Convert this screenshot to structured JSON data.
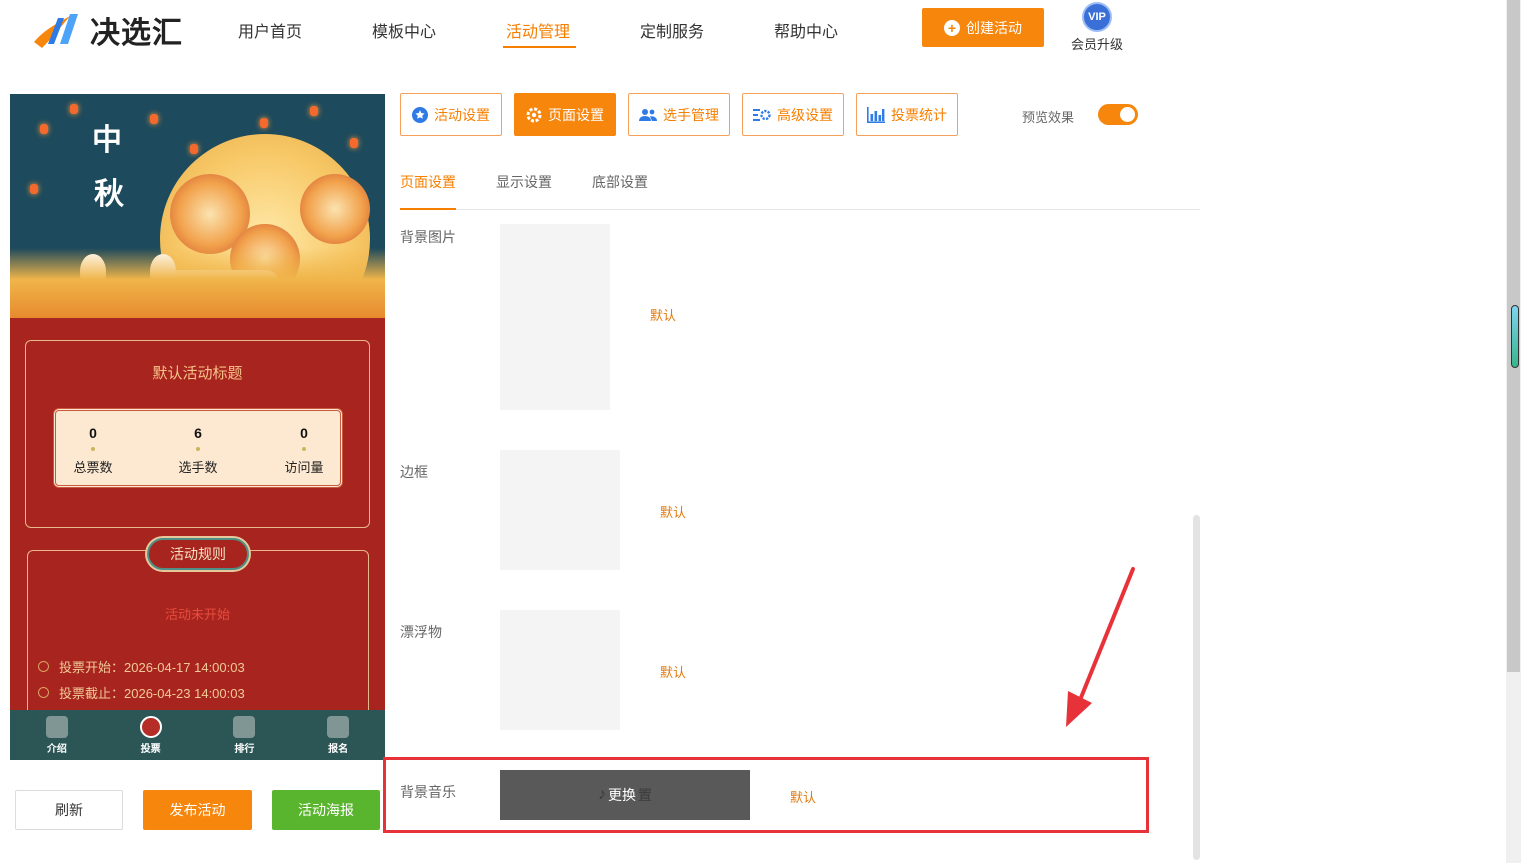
{
  "header": {
    "logo_text": "决选汇",
    "nav": [
      {
        "label": "用户首页"
      },
      {
        "label": "模板中心"
      },
      {
        "label": "活动管理",
        "active": true
      },
      {
        "label": "定制服务"
      },
      {
        "label": "帮助中心"
      }
    ],
    "create_button": "创建活动",
    "vip_badge": "VIP",
    "vip_label": "会员升级"
  },
  "preview": {
    "banner_text_1": "中",
    "banner_text_2": "秋",
    "activity_title": "默认活动标题",
    "stats": [
      {
        "value": "0",
        "label": "总票数"
      },
      {
        "value": "6",
        "label": "选手数"
      },
      {
        "value": "0",
        "label": "访问量"
      }
    ],
    "rules_title": "活动规则",
    "status": "活动未开始",
    "vote_start": "投票开始：2026-04-17 14:00:03",
    "vote_end": "投票截止：2026-04-23 14:00:03",
    "tabbar": [
      {
        "label": "介绍"
      },
      {
        "label": "投票",
        "active": true
      },
      {
        "label": "排行"
      },
      {
        "label": "报名"
      }
    ]
  },
  "actions": {
    "refresh": "刷新",
    "publish": "发布活动",
    "poster": "活动海报"
  },
  "toolbar": {
    "items": [
      {
        "label": "活动设置",
        "icon": "star-icon"
      },
      {
        "label": "页面设置",
        "icon": "gear-icon",
        "active": true
      },
      {
        "label": "选手管理",
        "icon": "users-icon"
      },
      {
        "label": "高级设置",
        "icon": "settings-list-icon"
      },
      {
        "label": "投票统计",
        "icon": "bar-chart-icon"
      }
    ],
    "preview_label": "预览效果",
    "preview_enabled": true
  },
  "subtabs": [
    {
      "label": "页面设置",
      "active": true
    },
    {
      "label": "显示设置"
    },
    {
      "label": "底部设置"
    }
  ],
  "fields": {
    "background_image": {
      "label": "背景图片",
      "default_link": "默认"
    },
    "border": {
      "label": "边框",
      "default_link": "默认"
    },
    "floating": {
      "label": "漂浮物",
      "default_link": "默认"
    },
    "background_music": {
      "label": "背景音乐",
      "change_button": "更换",
      "underlay_text": "置",
      "default_link": "默认"
    }
  },
  "colors": {
    "accent": "#f7860d",
    "highlight": "#e8323a",
    "green": "#5ab52e"
  }
}
